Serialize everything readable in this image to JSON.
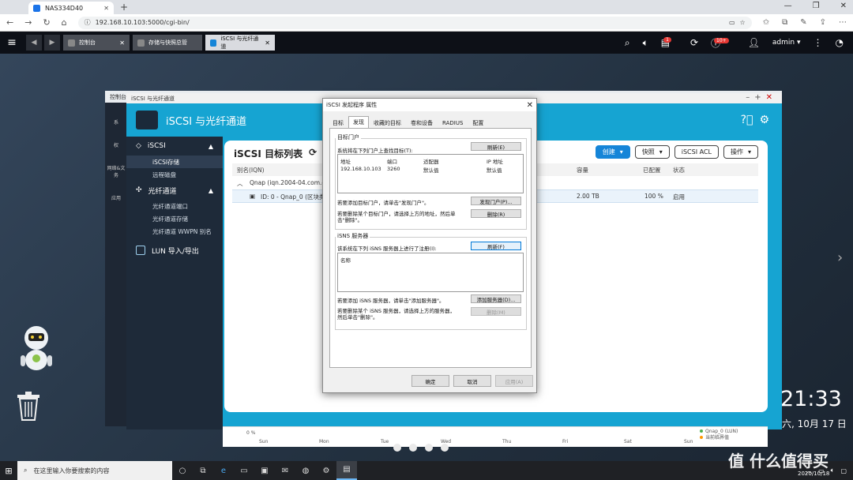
{
  "browser": {
    "tab_title": "NAS334D40",
    "url": "192.168.10.103:5000/cgi-bin/"
  },
  "qts": {
    "tabs": [
      "控制台",
      "存储与快照总管",
      "iSCSI 与光纤通道"
    ],
    "notif_badge": "1",
    "alert_badge": "10+",
    "user": "admin"
  },
  "control_panel": {
    "title": "控制台",
    "side_labels": [
      "系",
      "权",
      "网络&文\n务",
      "应用"
    ]
  },
  "app": {
    "window_title": "iSCSI 与光纤通道",
    "header": "iSCSI 与光纤通道",
    "nav": {
      "iscsi": "iSCSI",
      "iscsi_storage": "iSCSI存储",
      "remote_disk": "远程磁盘",
      "fc": "光纤通道",
      "fc_port": "光纤通道端口",
      "fc_storage": "光纤通道存储",
      "fc_wwpn": "光纤通道 WWPN 别名",
      "lun_io": "LUN 导入/导出"
    },
    "content_title": "iSCSI 目标列表",
    "toolbar": {
      "create": "创建",
      "snapshot": "快照",
      "acl": "iSCSI ACL",
      "action": "操作"
    },
    "table": {
      "headers": {
        "alias": "别名(IQN)",
        "capacity": "容量",
        "allocated": "已配置",
        "status": "状态"
      },
      "group_row": "Qnap (iqn.2004-04.com.qna",
      "lun_row": {
        "name": "ID: 0 - Qnap_0 (区块类型",
        "capacity": "2.00 TB",
        "allocated": "100 %",
        "status": "启用"
      }
    }
  },
  "chart": {
    "ylabel": "0 %",
    "days": [
      "Sun",
      "Mon",
      "Tue",
      "Wed",
      "Thu",
      "Fri",
      "Sat",
      "Sun"
    ],
    "legend": [
      "Qnap_0 (LUN)",
      "当前临界值"
    ]
  },
  "desktop": {
    "time": "21:33",
    "date": "六, 10月 17 日"
  },
  "dialog": {
    "title": "iSCSI 发起程序 属性",
    "tabs": [
      "目标",
      "发现",
      "收藏的目标",
      "卷和设备",
      "RADIUS",
      "配置"
    ],
    "portal_group": "目标门户",
    "portal_desc": "系统将在下列门户上查找目标(T):",
    "refresh": "刷新(E)",
    "portal_cols": [
      "地址",
      "端口",
      "适配器",
      "IP 地址"
    ],
    "portal_row": [
      "192.168.10.103",
      "3260",
      "默认值",
      "默认值"
    ],
    "add_portal_hint": "若要添加目标门户，请单击\"发现门户\"。",
    "discover_portal": "发现门户(P)...",
    "remove_portal_hint_1": "若要删除某个目标门户，请选择上方的地址，然后单",
    "remove_portal_hint_2": "击\"删除\"。",
    "remove": "删除(R)",
    "isns_group": "iSNS 服务器",
    "isns_desc": "该系统在下列 iSNS 服务器上进行了注册(I):",
    "isns_refresh": "刷新(F)",
    "isns_col": "名称",
    "add_server_hint": "若要添加 iSNS 服务器，请单击\"添加服务器\"。",
    "add_server": "添加服务器(D)...",
    "remove_server_hint_1": "若要删除某个 iSNS 服务器，请选择上方的服务器，",
    "remove_server_hint_2": "然后单击\"删除\"。",
    "remove_server": "删除(M)",
    "ok": "确定",
    "cancel": "取消",
    "apply": "应用(A)"
  },
  "taskbar": {
    "search_placeholder": "在这里输入你要搜索的内容",
    "date": "2020/10/18"
  },
  "watermark": "值 什么值得买"
}
